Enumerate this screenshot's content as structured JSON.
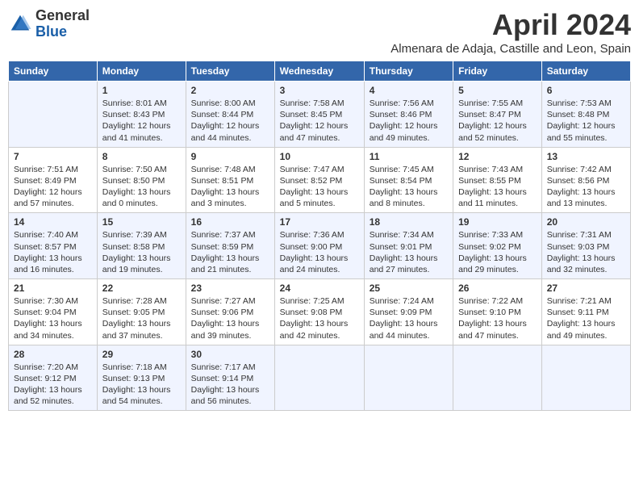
{
  "header": {
    "logo_general": "General",
    "logo_blue": "Blue",
    "month_title": "April 2024",
    "location": "Almenara de Adaja, Castille and Leon, Spain"
  },
  "days_of_week": [
    "Sunday",
    "Monday",
    "Tuesday",
    "Wednesday",
    "Thursday",
    "Friday",
    "Saturday"
  ],
  "weeks": [
    [
      {
        "day": "",
        "info": ""
      },
      {
        "day": "1",
        "info": "Sunrise: 8:01 AM\nSunset: 8:43 PM\nDaylight: 12 hours\nand 41 minutes."
      },
      {
        "day": "2",
        "info": "Sunrise: 8:00 AM\nSunset: 8:44 PM\nDaylight: 12 hours\nand 44 minutes."
      },
      {
        "day": "3",
        "info": "Sunrise: 7:58 AM\nSunset: 8:45 PM\nDaylight: 12 hours\nand 47 minutes."
      },
      {
        "day": "4",
        "info": "Sunrise: 7:56 AM\nSunset: 8:46 PM\nDaylight: 12 hours\nand 49 minutes."
      },
      {
        "day": "5",
        "info": "Sunrise: 7:55 AM\nSunset: 8:47 PM\nDaylight: 12 hours\nand 52 minutes."
      },
      {
        "day": "6",
        "info": "Sunrise: 7:53 AM\nSunset: 8:48 PM\nDaylight: 12 hours\nand 55 minutes."
      }
    ],
    [
      {
        "day": "7",
        "info": "Sunrise: 7:51 AM\nSunset: 8:49 PM\nDaylight: 12 hours\nand 57 minutes."
      },
      {
        "day": "8",
        "info": "Sunrise: 7:50 AM\nSunset: 8:50 PM\nDaylight: 13 hours\nand 0 minutes."
      },
      {
        "day": "9",
        "info": "Sunrise: 7:48 AM\nSunset: 8:51 PM\nDaylight: 13 hours\nand 3 minutes."
      },
      {
        "day": "10",
        "info": "Sunrise: 7:47 AM\nSunset: 8:52 PM\nDaylight: 13 hours\nand 5 minutes."
      },
      {
        "day": "11",
        "info": "Sunrise: 7:45 AM\nSunset: 8:54 PM\nDaylight: 13 hours\nand 8 minutes."
      },
      {
        "day": "12",
        "info": "Sunrise: 7:43 AM\nSunset: 8:55 PM\nDaylight: 13 hours\nand 11 minutes."
      },
      {
        "day": "13",
        "info": "Sunrise: 7:42 AM\nSunset: 8:56 PM\nDaylight: 13 hours\nand 13 minutes."
      }
    ],
    [
      {
        "day": "14",
        "info": "Sunrise: 7:40 AM\nSunset: 8:57 PM\nDaylight: 13 hours\nand 16 minutes."
      },
      {
        "day": "15",
        "info": "Sunrise: 7:39 AM\nSunset: 8:58 PM\nDaylight: 13 hours\nand 19 minutes."
      },
      {
        "day": "16",
        "info": "Sunrise: 7:37 AM\nSunset: 8:59 PM\nDaylight: 13 hours\nand 21 minutes."
      },
      {
        "day": "17",
        "info": "Sunrise: 7:36 AM\nSunset: 9:00 PM\nDaylight: 13 hours\nand 24 minutes."
      },
      {
        "day": "18",
        "info": "Sunrise: 7:34 AM\nSunset: 9:01 PM\nDaylight: 13 hours\nand 27 minutes."
      },
      {
        "day": "19",
        "info": "Sunrise: 7:33 AM\nSunset: 9:02 PM\nDaylight: 13 hours\nand 29 minutes."
      },
      {
        "day": "20",
        "info": "Sunrise: 7:31 AM\nSunset: 9:03 PM\nDaylight: 13 hours\nand 32 minutes."
      }
    ],
    [
      {
        "day": "21",
        "info": "Sunrise: 7:30 AM\nSunset: 9:04 PM\nDaylight: 13 hours\nand 34 minutes."
      },
      {
        "day": "22",
        "info": "Sunrise: 7:28 AM\nSunset: 9:05 PM\nDaylight: 13 hours\nand 37 minutes."
      },
      {
        "day": "23",
        "info": "Sunrise: 7:27 AM\nSunset: 9:06 PM\nDaylight: 13 hours\nand 39 minutes."
      },
      {
        "day": "24",
        "info": "Sunrise: 7:25 AM\nSunset: 9:08 PM\nDaylight: 13 hours\nand 42 minutes."
      },
      {
        "day": "25",
        "info": "Sunrise: 7:24 AM\nSunset: 9:09 PM\nDaylight: 13 hours\nand 44 minutes."
      },
      {
        "day": "26",
        "info": "Sunrise: 7:22 AM\nSunset: 9:10 PM\nDaylight: 13 hours\nand 47 minutes."
      },
      {
        "day": "27",
        "info": "Sunrise: 7:21 AM\nSunset: 9:11 PM\nDaylight: 13 hours\nand 49 minutes."
      }
    ],
    [
      {
        "day": "28",
        "info": "Sunrise: 7:20 AM\nSunset: 9:12 PM\nDaylight: 13 hours\nand 52 minutes."
      },
      {
        "day": "29",
        "info": "Sunrise: 7:18 AM\nSunset: 9:13 PM\nDaylight: 13 hours\nand 54 minutes."
      },
      {
        "day": "30",
        "info": "Sunrise: 7:17 AM\nSunset: 9:14 PM\nDaylight: 13 hours\nand 56 minutes."
      },
      {
        "day": "",
        "info": ""
      },
      {
        "day": "",
        "info": ""
      },
      {
        "day": "",
        "info": ""
      },
      {
        "day": "",
        "info": ""
      }
    ]
  ]
}
